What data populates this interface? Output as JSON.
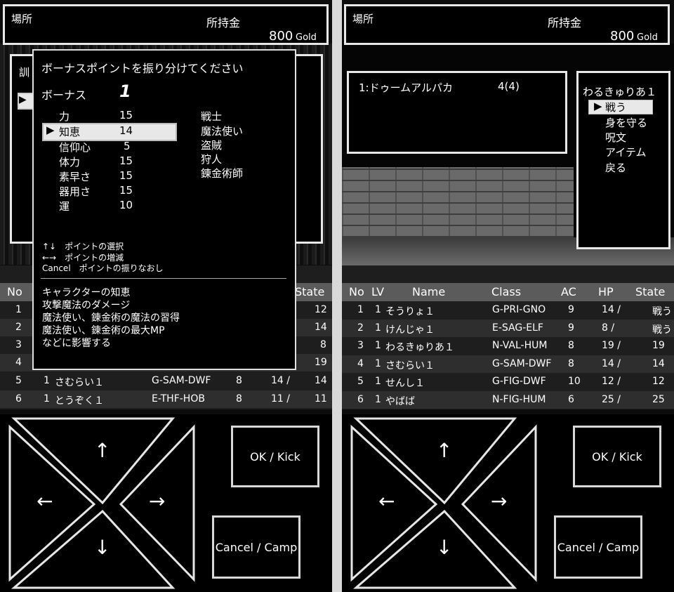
{
  "header": {
    "place_label": "場所",
    "gold_label": "所持金",
    "gold_value": "800",
    "gold_unit": "Gold"
  },
  "bonus_dialog": {
    "title": "ボーナスポイントを振り分けてください",
    "bonus_label": "ボーナス",
    "bonus_value": "1",
    "stats": [
      {
        "label": "力",
        "value": "15"
      },
      {
        "label": "知恵",
        "value": "14"
      },
      {
        "label": "信仰心",
        "value": "5"
      },
      {
        "label": "体力",
        "value": "15"
      },
      {
        "label": "素早さ",
        "value": "15"
      },
      {
        "label": "器用さ",
        "value": "15"
      },
      {
        "label": "運",
        "value": "10"
      }
    ],
    "selected_index": 1,
    "classes": [
      "戦士",
      "魔法使い",
      "盗賊",
      "狩人",
      "錬金術師"
    ],
    "help": [
      "↑↓　ポイントの選択",
      "←→　ポイントの増減",
      "Cancel　ポイントの振りなおし"
    ],
    "description": [
      "キャラクターの知恵",
      "攻撃魔法のダメージ",
      "魔法使い、錬金術の魔法の習得",
      "魔法使い、錬金術の最大MP",
      "などに影響する"
    ],
    "cursor_glyph": "▶"
  },
  "behind_dialog": {
    "partial_label": "訓"
  },
  "party_table": {
    "headers": [
      "No",
      "LV",
      "Name",
      "Class",
      "AC",
      "HP",
      "State"
    ],
    "rows": [
      {
        "no": "1",
        "lv": "1",
        "name": "そうりょ１",
        "cls": "G-PRI-GNO",
        "ac": "9",
        "hp": "14 /",
        "state": "戦う",
        "state_left": "12"
      },
      {
        "no": "2",
        "lv": "1",
        "name": "けんじゃ１",
        "cls": "E-SAG-ELF",
        "ac": "9",
        "hp": "8 /",
        "state": "戦う",
        "state_left": "14"
      },
      {
        "no": "3",
        "lv": "1",
        "name": "わるきゅりあ１",
        "cls": "N-VAL-HUM",
        "ac": "8",
        "hp": "19 /",
        "state": "19",
        "state_left": "8"
      },
      {
        "no": "4",
        "lv": "1",
        "name": "さむらい１",
        "cls": "G-SAM-DWF",
        "ac": "8",
        "hp": "14 /",
        "state": "14",
        "state_left": "19"
      },
      {
        "no": "5",
        "lv": "1",
        "name": "せんし１",
        "cls": "G-FIG-DWF",
        "ac": "10",
        "hp": "12 /",
        "state": "12",
        "state_left": "14"
      },
      {
        "no": "6",
        "lv": "1",
        "name": "やばば",
        "cls": "N-FIG-HUM",
        "ac": "6",
        "hp": "25 /",
        "state": "25",
        "state_left": "11"
      }
    ],
    "left_rows": [
      {
        "no": "5",
        "lv": "1",
        "name": "さむらい１",
        "cls": "G-SAM-DWF",
        "ac": "8",
        "hp": "14 /"
      },
      {
        "no": "6",
        "lv": "1",
        "name": "とうぞく１",
        "cls": "E-THF-HOB",
        "ac": "8",
        "hp": "11 /"
      }
    ]
  },
  "battle": {
    "enemy_group": "1:ドゥームアルパカ",
    "enemy_count": "4(4)",
    "actor": "わるきゅりあ１",
    "commands": [
      "戦う",
      "身を守る",
      "呪文",
      "アイテム",
      "戻る"
    ],
    "selected_command": 0
  },
  "controls": {
    "ok_label": "OK / Kick",
    "cancel_label": "Cancel / Camp",
    "up": "↑",
    "down": "↓",
    "left": "←",
    "right": "→"
  }
}
